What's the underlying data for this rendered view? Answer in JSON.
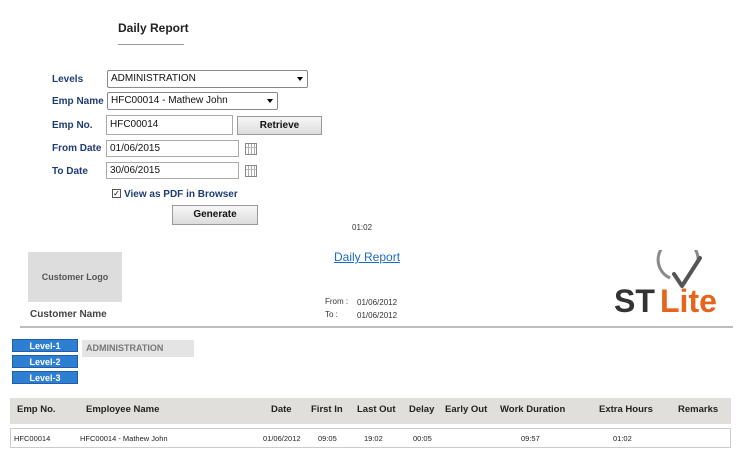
{
  "page": {
    "title": "Daily Report"
  },
  "form": {
    "levels_label": "Levels",
    "levels_value": "ADMINISTRATION",
    "emp_name_label": "Emp Name",
    "emp_name_value": "HFC00014 - Mathew John",
    "emp_no_label": "Emp No.",
    "emp_no_value": "HFC00014",
    "retrieve_label": "Retrieve",
    "from_date_label": "From Date",
    "from_date_value": "01/06/2015",
    "to_date_label": "To Date",
    "to_date_value": "30/06/2015",
    "pdf_checkbox_label": "View as PDF in Browser",
    "pdf_checked": true,
    "generate_label": "Generate"
  },
  "timer": "01:02",
  "report": {
    "title": "Daily Report",
    "customer_logo": "Customer Logo",
    "customer_name": "Customer Name",
    "from_label": "From :",
    "from_value": "01/06/2012",
    "to_label": "To :",
    "to_value": "01/06/2012",
    "brand_st": "ST",
    "brand_lite": "Lite",
    "levels": [
      "Level-1",
      "Level-2",
      "Level-3"
    ],
    "level_tag": "ADMINISTRATION",
    "columns": [
      "Emp No.",
      "Employee Name",
      "Date",
      "First In",
      "Last Out",
      "Delay",
      "Early Out",
      "Work Duration",
      "Extra Hours",
      "Remarks"
    ],
    "rows": [
      {
        "emp_no": "HFC00014",
        "name": "HFC00014 - Mathew John",
        "date": "01/06/2012",
        "first_in": "09:05",
        "last_out": "19:02",
        "delay": "00:05",
        "early_out": "",
        "work_duration": "09:57",
        "extra_hours": "01:02",
        "remarks": ""
      }
    ]
  },
  "colors": {
    "label_blue": "#1f3b73",
    "tab_blue": "#2e7ed3",
    "brand_orange": "#e8641b",
    "link_blue": "#1a6bc2"
  }
}
